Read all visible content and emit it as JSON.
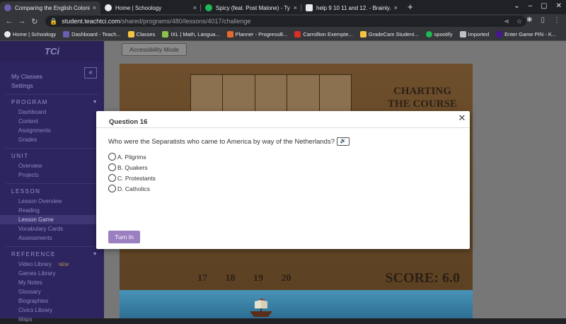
{
  "browser": {
    "tabs": [
      {
        "title": "Comparing the English Colonies",
        "icon": "teachtci-favicon",
        "color": "#6a5fb0",
        "active": true
      },
      {
        "title": "Home | Schoology",
        "icon": "schoology-favicon",
        "color": "#e8eaed",
        "active": false
      },
      {
        "title": "Spicy (feat. Post Malone) - Ty",
        "icon": "spotify-favicon",
        "color": "#1db954",
        "active": false
      },
      {
        "title": "help 9 10 11 and 12. - Brainly.co",
        "icon": "brainly-favicon",
        "color": "#e8eaed",
        "active": false
      }
    ],
    "close_glyph": "×",
    "new_tab": "+",
    "url_host": "student.teachtci.com",
    "url_path": "/shared/programs/480/lessons/4017/challenge",
    "bookmarks": [
      {
        "label": "Home | Schoology",
        "color": "#e8eaed"
      },
      {
        "label": "Dashboard - Teach...",
        "color": "#6a5fb0"
      },
      {
        "label": "Classes",
        "color": "#f4c542"
      },
      {
        "label": "IXL | Math, Langua...",
        "color": "#8bc34a"
      },
      {
        "label": "Planner - ProgressB...",
        "color": "#e8692c"
      },
      {
        "label": "Carrollton Exempte...",
        "color": "#d93025"
      },
      {
        "label": "GradeCam Student...",
        "color": "#f4c542"
      },
      {
        "label": "spootify",
        "color": "#1db954"
      },
      {
        "label": "Imported",
        "color": "#bdc1c6"
      },
      {
        "label": "Enter Game PIN - K...",
        "color": "#46178f"
      }
    ]
  },
  "sidebar": {
    "logo": "TCi",
    "collapse_glyph": "«",
    "top_links": [
      "My Classes",
      "Settings"
    ],
    "sections": [
      {
        "heading": "PROGRAM",
        "items": [
          "Dashboard",
          "Content",
          "Assignments",
          "Grades"
        ]
      },
      {
        "heading": "UNIT",
        "items": [
          "Overview",
          "Projects"
        ]
      },
      {
        "heading": "LESSON",
        "items": [
          "Lesson Overview",
          "Reading",
          "Lesson Game",
          "Vocabulary Cards",
          "Assessments"
        ]
      },
      {
        "heading": "REFERENCE",
        "items": [
          "Video Library",
          "Games Library",
          "My Notes",
          "Glossary",
          "Biographies",
          "Civics Library",
          "Maps"
        ]
      }
    ],
    "new_badge": "NEW"
  },
  "main": {
    "accessibility_button": "Accessibility Mode",
    "game_title_line1": "CHARTING",
    "game_title_line2": "THE COURSE",
    "score_text": "SCORE:  6.0",
    "bottom_numbers": "17 18 19 20"
  },
  "modal": {
    "title": "Question 16",
    "close_glyph": "✕",
    "question": "Who were the Separatists who came to America by way of the Netherlands?",
    "audio_glyph": "🔊",
    "options": [
      "A. Pilgrims",
      "B. Quakers",
      "C. Protestants",
      "D. Catholics"
    ],
    "submit_label": "Turn In",
    "accent_color": "#9b7fc0"
  }
}
